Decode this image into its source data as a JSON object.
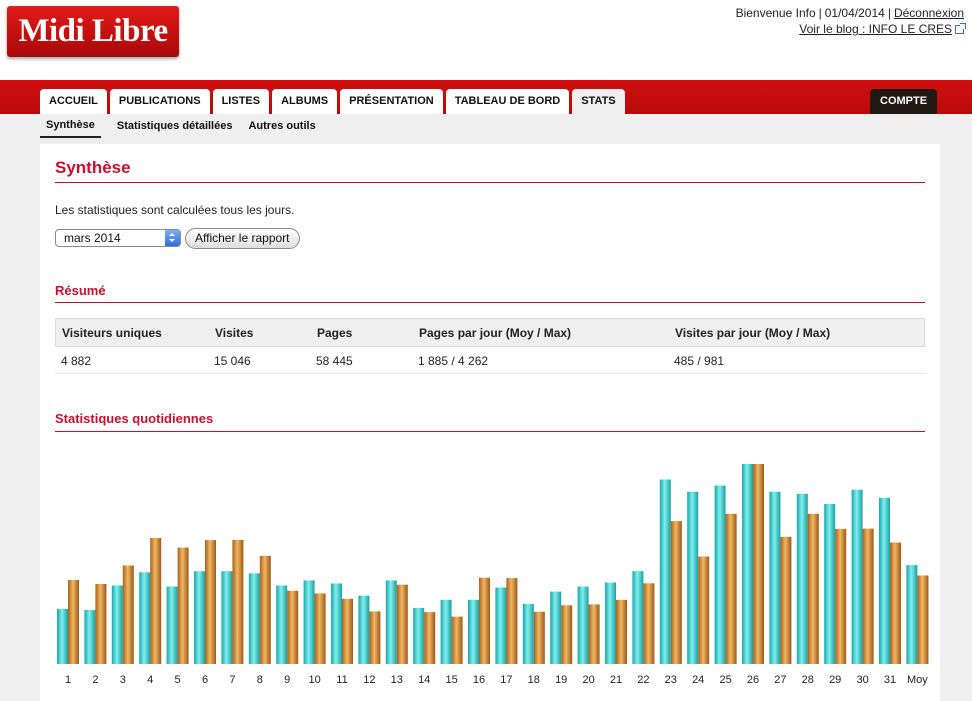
{
  "header": {
    "logo_text": "Midi Libre",
    "welcome": "Bienvenue Info",
    "date": "01/04/2014",
    "logout": "Déconnexion",
    "blog_link": "Voir le blog : INFO LE CRES"
  },
  "nav": {
    "tabs": [
      "ACCUEIL",
      "PUBLICATIONS",
      "LISTES",
      "ALBUMS",
      "PRÉSENTATION",
      "TABLEAU DE BORD",
      "STATS"
    ],
    "active_tab": "STATS",
    "account": "COMPTE"
  },
  "subnav": {
    "items": [
      "Synthèse",
      "Statistiques détaillées",
      "Autres outils"
    ]
  },
  "main": {
    "title": "Synthèse",
    "description": "Les statistiques sont calculées tous les jours.",
    "month_select": "mars 2014",
    "report_button": "Afficher le rapport"
  },
  "summary": {
    "title": "Résumé",
    "columns": [
      "Visiteurs uniques",
      "Visites",
      "Pages",
      "Pages par jour (Moy / Max)",
      "Visites par jour (Moy / Max)"
    ],
    "values": [
      "4 882",
      "15 046",
      "58 445",
      "1 885 / 4 262",
      "485 / 981"
    ]
  },
  "daily": {
    "title": "Statistiques quotidiennes"
  },
  "colors": {
    "brand_red": "#c8102e",
    "series_teal": "#2cc9c9",
    "series_orange": "#d98c2e"
  },
  "chart_data": {
    "type": "bar",
    "categories": [
      "1",
      "2",
      "3",
      "4",
      "5",
      "6",
      "7",
      "8",
      "9",
      "10",
      "11",
      "12",
      "13",
      "14",
      "15",
      "16",
      "17",
      "18",
      "19",
      "20",
      "21",
      "22",
      "23",
      "24",
      "25",
      "26",
      "27",
      "28",
      "29",
      "30",
      "31",
      "Moy"
    ],
    "series": [
      {
        "values": [
          270,
          265,
          385,
          450,
          380,
          455,
          455,
          445,
          385,
          410,
          395,
          335,
          410,
          275,
          315,
          315,
          375,
          295,
          355,
          380,
          400,
          455,
          905,
          845,
          875,
          981,
          845,
          835,
          785,
          855,
          815,
          485
        ]
      },
      {
        "values": [
          1790,
          1705,
          2100,
          2685,
          2480,
          2640,
          2645,
          2305,
          1560,
          1505,
          1390,
          1120,
          1690,
          1105,
          1010,
          1840,
          1830,
          1115,
          1250,
          1270,
          1365,
          1720,
          3045,
          2290,
          3200,
          4262,
          2710,
          3200,
          2880,
          2885,
          2590,
          1885
        ]
      }
    ],
    "ylim_visits": [
      0,
      981
    ],
    "ylim_pages": [
      0,
      4262
    ]
  }
}
